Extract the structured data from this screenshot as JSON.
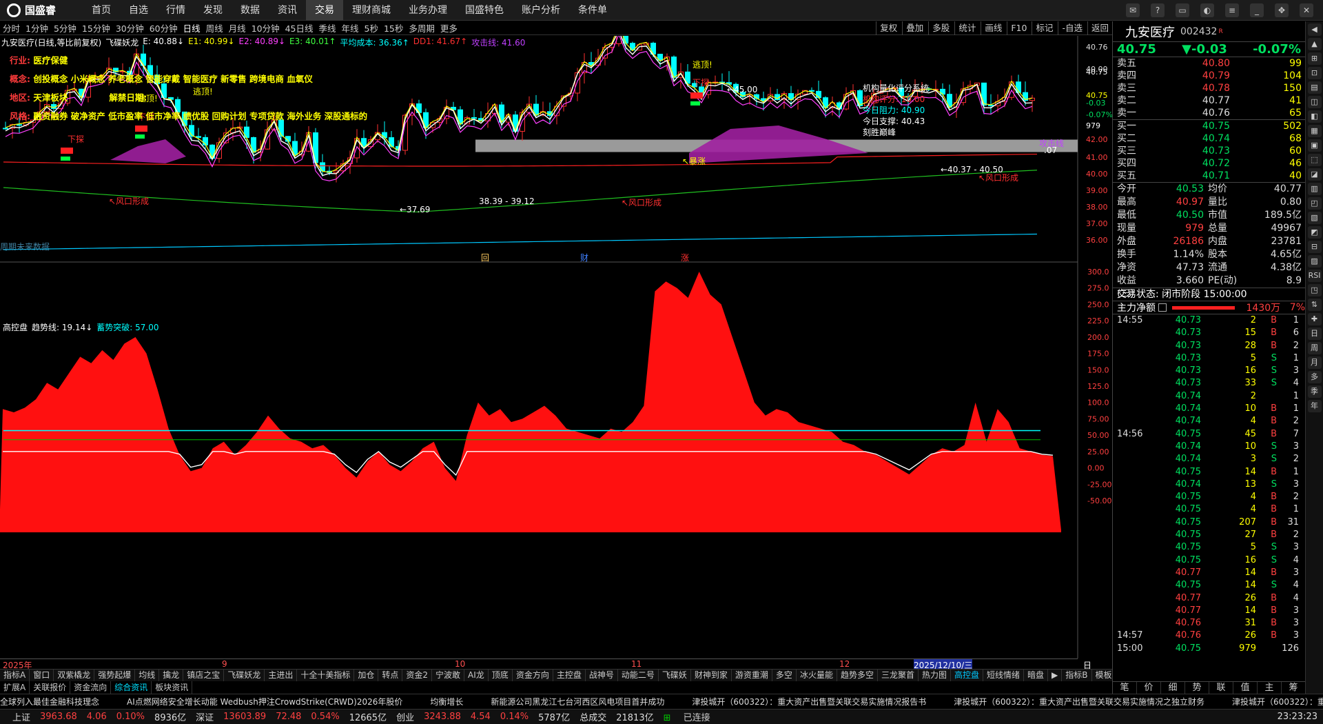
{
  "nav": {
    "logo": "国盛睿",
    "items": [
      "首页",
      "自选",
      "行情",
      "发现",
      "数据",
      "资讯",
      "交易",
      "理财商城",
      "业务办理",
      "国盛特色",
      "账户分析",
      "条件单"
    ],
    "active": 6
  },
  "periods": {
    "items": [
      "分时",
      "1分钟",
      "5分钟",
      "15分钟",
      "30分钟",
      "60分钟",
      "日线",
      "周线",
      "月线",
      "10分钟",
      "45日线",
      "季线",
      "年线",
      "5秒",
      "15秒",
      "多周期",
      "更多"
    ],
    "active": 6
  },
  "tools": [
    "复权",
    "叠加",
    "多股",
    "统计",
    "画线",
    "F10",
    "标记",
    "-自选",
    "返回"
  ],
  "legend": [
    {
      "t": "九安医疗(日线,等比前复权)",
      "c": "#ffffff"
    },
    {
      "t": "飞碟妖龙",
      "c": "#ffffff"
    },
    {
      "t": "E: 40.88↓",
      "c": "#ffffff"
    },
    {
      "t": "E1: 40.99↓",
      "c": "#ffff00"
    },
    {
      "t": "E2: 40.89↓",
      "c": "#ff40ff"
    },
    {
      "t": "E3: 40.01↑",
      "c": "#40ff40"
    },
    {
      "t": "平均成本: 36.36↑",
      "c": "#00ffff"
    },
    {
      "t": "DD1: 41.67↑",
      "c": "#ff3030"
    },
    {
      "t": "攻击线: 41.60",
      "c": "#c040ff"
    }
  ],
  "info": [
    {
      "k": "行业: ",
      "v": "医疗保健"
    },
    {
      "k": "概念: ",
      "v": "创投概念 小米概念 养老概念 智能穿戴 智能医疗 新零售 跨境电商 血氧仪"
    },
    {
      "k": "地区: ",
      "v": "天津板块",
      "k2": "解禁日期: ",
      "v2": ""
    },
    {
      "k": "风格: ",
      "v": "融资融券 破净资产 低市盈率 低市净率 绩优股 回购计划 专项贷款 海外业务 深股通标的"
    }
  ],
  "annot": {
    "xiatan": "下探",
    "taoni": "逃顶!",
    "fengkou": "风口形成",
    "baozhang": "暴涨",
    "lo1": "37.69",
    "lo2": "38.39 - 39.12",
    "hi1": "45.00",
    "r1": "40.37 - 40.50",
    "gjx": "攻击线",
    "gjx_v": ".07",
    "cai": "财",
    "zhang": "涨",
    "hui": "回",
    "bottom_text": "周期未来数据"
  },
  "quant": {
    "title": "机构量化评分系统",
    "l1": "机构评分: ",
    "v1": "10.00",
    "l2": "今日阻力: ",
    "v2": "40.90",
    "l3": "今日支撑: ",
    "v3": "40.43",
    "l4": "刻胜巅峰"
  },
  "price_axis": [
    "40.76",
    "40.00",
    "40.75",
    "40.75",
    "-0.03",
    "-0.07%",
    "979",
    "42.00",
    "41.00",
    "40.00",
    "39.00",
    "38.00",
    "37.00",
    "36.00"
  ],
  "indicator": {
    "name": "高控盘",
    "t1": "趋势线: 19.14↓",
    "t2": "蓄势突破: 57.00"
  },
  "ind_axis": [
    "300.0",
    "275.0",
    "250.0",
    "225.0",
    "200.0",
    "175.0",
    "150.0",
    "125.0",
    "100.0",
    "75.00",
    "50.00",
    "25.00",
    "0.00",
    "-25.00",
    "-50.00"
  ],
  "x_labels": [
    "2025年",
    "9",
    "10",
    "11",
    "12",
    "2025/12/10/三"
  ],
  "tabs": [
    "指标A",
    "窗口",
    "双紫橇龙",
    "强势起爆",
    "均线",
    "擒龙",
    "镇店之宝",
    "飞碟妖龙",
    "主进出",
    "十全十美指标",
    "加仓",
    "转点",
    "资金2",
    "宁波敢",
    "AI龙",
    "顶底",
    "资金方向",
    "主控盘",
    "战神号",
    "动能二号",
    "飞碟妖",
    "财神到家",
    "游资重潮",
    "多空",
    "冰火量能",
    "趋势多空",
    "三龙聚首",
    "热力图",
    "高控盘",
    "短线情绪",
    "暗盘"
  ],
  "tab_active": 28,
  "tabs_right": [
    "指标B",
    "模板"
  ],
  "tabs2": [
    "扩展A",
    "关联报价",
    "资金流向",
    "综合资讯",
    "板块资讯"
  ],
  "tabs2_active": 3,
  "ticker": [
    "全球列入最佳金融科技理念",
    "AI点燃网络安全增长动能 Wedbush押注CrowdStrike(CRWD)2026年股价",
    "均衡增长",
    "新能源公司黑龙江七台河西区风电项目首并成功",
    "津投城开（600322）：重大资产出售暨关联交易实施情况报告书",
    "津投城开（600322）：重大资产出售暨关联交易实施情况之独立财务",
    "津投城开（600322）：重大"
  ],
  "status": {
    "sh": "上证",
    "sh_v": "3963.68",
    "sh_c": "4.06",
    "sh_p": "0.10%",
    "sh_a": "8936亿",
    "sz": "深证",
    "sz_v": "13603.89",
    "sz_c": "72.48",
    "sz_p": "0.54%",
    "sz_a": "12665亿",
    "cy": "创业",
    "cy_v": "3243.88",
    "cy_c": "4.54",
    "cy_p": "0.14%",
    "cy_a": "5787亿",
    "tot": "总成交",
    "tot_v": "21813亿",
    "conn": "已连接",
    "time": "23:23:23"
  },
  "quote": {
    "name": "九安医疗",
    "code": "002432",
    "tag": "R",
    "price": "40.75",
    "chg": "▼-0.03",
    "pct": "-0.07%",
    "asks": [
      {
        "l": "卖五",
        "p": "40.80",
        "v": "99"
      },
      {
        "l": "卖四",
        "p": "40.79",
        "v": "104"
      },
      {
        "l": "卖三",
        "p": "40.78",
        "v": "150"
      },
      {
        "l": "卖二",
        "p": "40.77",
        "v": "41"
      },
      {
        "l": "卖一",
        "p": "40.76",
        "v": "65"
      }
    ],
    "bids": [
      {
        "l": "买一",
        "p": "40.75",
        "v": "502"
      },
      {
        "l": "买二",
        "p": "40.74",
        "v": "68"
      },
      {
        "l": "买三",
        "p": "40.73",
        "v": "60"
      },
      {
        "l": "买四",
        "p": "40.72",
        "v": "46"
      },
      {
        "l": "买五",
        "p": "40.71",
        "v": "40"
      }
    ],
    "stats": [
      {
        "a": "今开",
        "b": "40.53",
        "bc": "dn",
        "c": "均价",
        "d": "40.77",
        "dc": "up"
      },
      {
        "a": "最高",
        "b": "40.97",
        "bc": "up",
        "c": "量比",
        "d": "0.80",
        "dc": "dn"
      },
      {
        "a": "最低",
        "b": "40.50",
        "bc": "dn",
        "c": "市值",
        "d": "189.5亿",
        "dc": "wh"
      },
      {
        "a": "现量",
        "b": "979",
        "bc": "up",
        "c": "总量",
        "d": "49967",
        "dc": "wh"
      },
      {
        "a": "外盘",
        "b": "26186",
        "bc": "up",
        "c": "内盘",
        "d": "23781",
        "dc": "dn"
      },
      {
        "a": "换手",
        "b": "1.14%",
        "bc": "wh",
        "c": "股本",
        "d": "4.65亿",
        "dc": "wh"
      },
      {
        "a": "净资",
        "b": "47.73",
        "bc": "wh",
        "c": "流通",
        "d": "4.38亿",
        "dc": "wh"
      },
      {
        "a": "收益(三)",
        "b": "3.660",
        "bc": "wh",
        "c": "PE(动)",
        "d": "8.9",
        "dc": "wh"
      }
    ],
    "state": "交易状态: 闭市阶段 15:00:00",
    "flow_l": "主力净额",
    "flow_v": "1430万",
    "flow_p": "7%",
    "ticks": [
      {
        "t": "14:55",
        "p": "40.73",
        "v": "2",
        "f": "B",
        "n": "1"
      },
      {
        "t": "",
        "p": "40.73",
        "v": "15",
        "f": "B",
        "n": "6"
      },
      {
        "t": "",
        "p": "40.73",
        "v": "28",
        "f": "B",
        "n": "2"
      },
      {
        "t": "",
        "p": "40.73",
        "v": "5",
        "f": "S",
        "n": "1"
      },
      {
        "t": "",
        "p": "40.73",
        "v": "16",
        "f": "S",
        "n": "3"
      },
      {
        "t": "",
        "p": "40.73",
        "v": "33",
        "f": "S",
        "n": "4"
      },
      {
        "t": "",
        "p": "40.74",
        "v": "2",
        "f": "",
        "n": "1"
      },
      {
        "t": "",
        "p": "40.74",
        "v": "10",
        "f": "B",
        "n": "1"
      },
      {
        "t": "",
        "p": "40.74",
        "v": "4",
        "f": "B",
        "n": "2"
      },
      {
        "t": "14:56",
        "p": "40.75",
        "v": "45",
        "f": "B",
        "n": "7"
      },
      {
        "t": "",
        "p": "40.74",
        "v": "10",
        "f": "S",
        "n": "3"
      },
      {
        "t": "",
        "p": "40.74",
        "v": "3",
        "f": "S",
        "n": "2"
      },
      {
        "t": "",
        "p": "40.75",
        "v": "14",
        "f": "B",
        "n": "1"
      },
      {
        "t": "",
        "p": "40.74",
        "v": "13",
        "f": "S",
        "n": "3"
      },
      {
        "t": "",
        "p": "40.75",
        "v": "4",
        "f": "B",
        "n": "2"
      },
      {
        "t": "",
        "p": "40.75",
        "v": "4",
        "f": "B",
        "n": "1"
      },
      {
        "t": "",
        "p": "40.75",
        "v": "207",
        "f": "B",
        "n": "31"
      },
      {
        "t": "",
        "p": "40.75",
        "v": "27",
        "f": "B",
        "n": "2"
      },
      {
        "t": "",
        "p": "40.75",
        "v": "5",
        "f": "S",
        "n": "3"
      },
      {
        "t": "",
        "p": "40.75",
        "v": "16",
        "f": "S",
        "n": "4"
      },
      {
        "t": "",
        "p": "40.77",
        "v": "14",
        "f": "B",
        "n": "3"
      },
      {
        "t": "",
        "p": "40.75",
        "v": "14",
        "f": "S",
        "n": "4"
      },
      {
        "t": "",
        "p": "40.77",
        "v": "26",
        "f": "B",
        "n": "4"
      },
      {
        "t": "",
        "p": "40.77",
        "v": "14",
        "f": "B",
        "n": "3"
      },
      {
        "t": "",
        "p": "40.76",
        "v": "31",
        "f": "B",
        "n": "3"
      },
      {
        "t": "14:57",
        "p": "40.76",
        "v": "26",
        "f": "B",
        "n": "3"
      },
      {
        "t": "15:00",
        "p": "40.75",
        "v": "979",
        "f": "",
        "n": "126"
      }
    ],
    "bottom_tabs": [
      "笔",
      "价",
      "细",
      "势",
      "联",
      "值",
      "主",
      "筹"
    ]
  },
  "sidestrip": [
    "◀",
    "▲",
    "⊞",
    "⊡",
    "▤",
    "◫",
    "◧",
    "▦",
    "▣",
    "⬚",
    "◪",
    "▥",
    "◰",
    "▧",
    "◩",
    "⊟",
    "▨",
    "RSI",
    "◳",
    "⇅",
    "✚",
    "日",
    "周",
    "月",
    "多",
    "季",
    "年"
  ]
}
